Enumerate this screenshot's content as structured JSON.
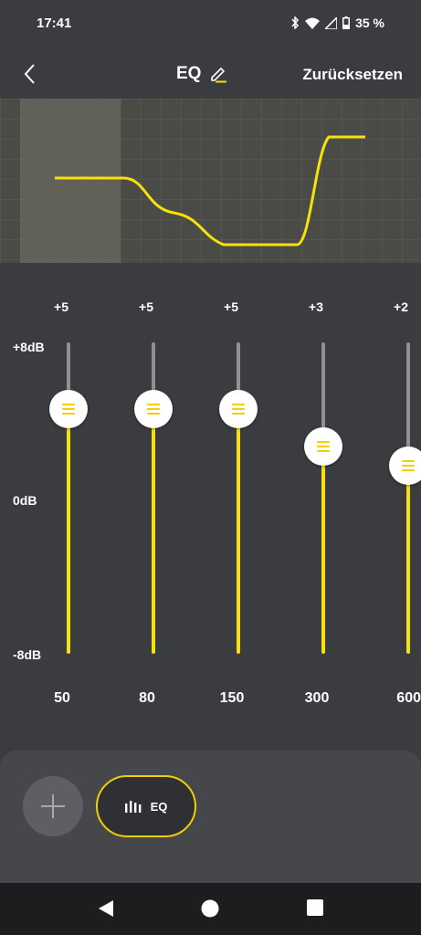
{
  "status_bar": {
    "time": "17:41",
    "battery_text": "35 %",
    "icons": [
      "bluetooth-icon",
      "wifi-icon",
      "cell-signal-icon",
      "battery-icon"
    ]
  },
  "header": {
    "back_icon": "chevron-left-icon",
    "title": "EQ",
    "edit_icon": "pencil-icon",
    "reset_label": "Zurücksetzen"
  },
  "scale": {
    "max_label": "+8dB",
    "mid_label": "0dB",
    "min_label": "-8dB",
    "max_db": 8,
    "min_db": -8
  },
  "bands": [
    {
      "gain_label": "+5",
      "gain": 5,
      "freq": "50"
    },
    {
      "gain_label": "+5",
      "gain": 5,
      "freq": "80"
    },
    {
      "gain_label": "+5",
      "gain": 5,
      "freq": "150"
    },
    {
      "gain_label": "+3",
      "gain": 3,
      "freq": "300"
    },
    {
      "gain_label": "+2",
      "gain": 2,
      "freq": "600"
    }
  ],
  "bottom": {
    "add_icon": "plus-icon",
    "preset_icon": "equalizer-bars-icon",
    "preset_label": "EQ"
  },
  "colors": {
    "accent": "#f7e10c",
    "background": "#3b3c40",
    "panel": "#46474b"
  },
  "nav": [
    "back-triangle-icon",
    "home-circle-icon",
    "recents-square-icon"
  ]
}
